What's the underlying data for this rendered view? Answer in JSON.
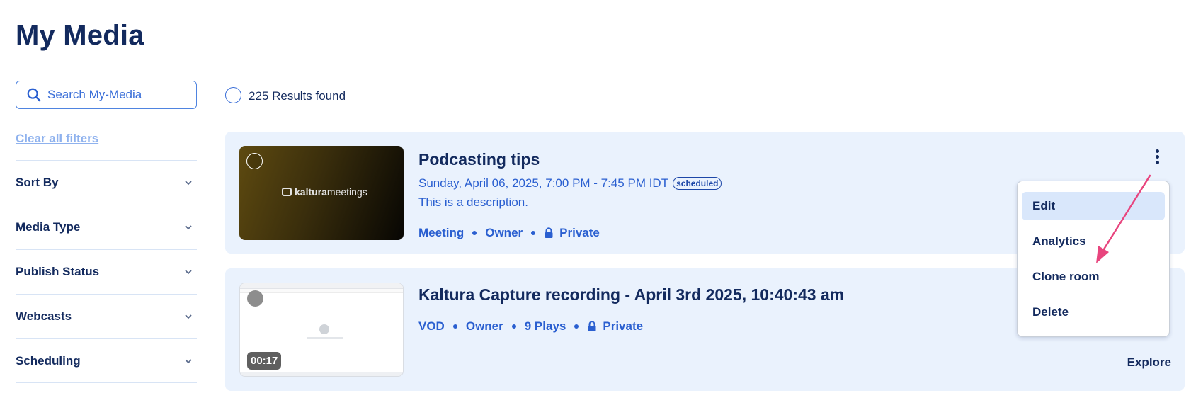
{
  "page": {
    "title": "My Media"
  },
  "sidebar": {
    "search_placeholder": "Search My-Media",
    "clear_filters": "Clear all filters",
    "filters": [
      {
        "label": "Sort By"
      },
      {
        "label": "Media Type"
      },
      {
        "label": "Publish Status"
      },
      {
        "label": "Webcasts"
      },
      {
        "label": "Scheduling"
      }
    ]
  },
  "results": {
    "count_text": "225 Results found"
  },
  "media": [
    {
      "title": "Podcasting tips",
      "schedule": "Sunday, April 06, 2025, 7:00 PM - 7:45 PM IDT",
      "badge": "scheduled",
      "description": "This is a description.",
      "thumbnail_brand_bold": "kaltura",
      "thumbnail_brand_rest": "meetings",
      "meta": [
        "Meeting",
        "Owner",
        "Private"
      ]
    },
    {
      "title": "Kaltura Capture recording - April 3rd 2025, 10:40:43 am",
      "duration": "00:17",
      "meta": [
        "VOD",
        "Owner",
        "9 Plays",
        "Private"
      ],
      "action": "Explore"
    }
  ],
  "menu": {
    "items": [
      {
        "label": "Edit",
        "active": true
      },
      {
        "label": "Analytics"
      },
      {
        "label": "Clone room"
      },
      {
        "label": "Delete"
      }
    ]
  },
  "colors": {
    "title": "#132a5e",
    "link_blue": "#2a5fd0",
    "card_bg": "#eaf2fd",
    "menu_active_bg": "#d9e7fb",
    "annotation_arrow": "#e8457e"
  },
  "icons": [
    "search-icon",
    "chevron-down-icon",
    "lock-icon",
    "more-vertical-icon",
    "annotation-arrow-icon"
  ]
}
